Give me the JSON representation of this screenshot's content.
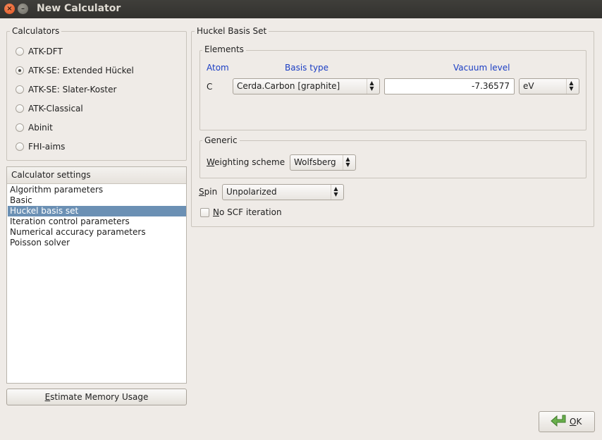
{
  "window": {
    "title": "New Calculator",
    "close_glyph": "×",
    "minimize_glyph": "–"
  },
  "calculators": {
    "title": "Calculators",
    "options": [
      {
        "label": "ATK-DFT",
        "checked": false
      },
      {
        "label": "ATK-SE: Extended Hückel",
        "checked": true
      },
      {
        "label": "ATK-SE: Slater-Koster",
        "checked": false
      },
      {
        "label": "ATK-Classical",
        "checked": false
      },
      {
        "label": "Abinit",
        "checked": false
      },
      {
        "label": "FHI-aims",
        "checked": false
      }
    ]
  },
  "settings": {
    "header": "Calculator settings",
    "items": [
      "Algorithm parameters",
      "Basic",
      "Huckel basis set",
      "Iteration control parameters",
      "Numerical accuracy parameters",
      "Poisson solver"
    ],
    "selected_index": 2
  },
  "estimate_button": {
    "label_first": "E",
    "label_rest": "stimate Memory Usage"
  },
  "basis": {
    "title": "Huckel Basis Set",
    "elements": {
      "title": "Elements",
      "col_atom": "Atom",
      "col_basis": "Basis type",
      "col_vacuum": "Vacuum level",
      "row": {
        "atom": "C",
        "basis_type": "Cerda.Carbon [graphite]",
        "vacuum_level": "-7.36577",
        "unit": "eV"
      }
    },
    "generic": {
      "title": "Generic",
      "weighting_label_first": "W",
      "weighting_label_rest": "eighting scheme",
      "weighting_value": "Wolfsberg"
    },
    "spin": {
      "label_first": "S",
      "label_rest": "pin",
      "value": "Unpolarized"
    },
    "no_scf": {
      "label_first": "N",
      "label_rest": "o SCF iteration",
      "checked": false
    }
  },
  "ok_button": {
    "label_first": "O",
    "label_rest": "K",
    "icon": "green-arrow-icon"
  },
  "icons": {
    "combo_arrows": "⏶⏷"
  }
}
